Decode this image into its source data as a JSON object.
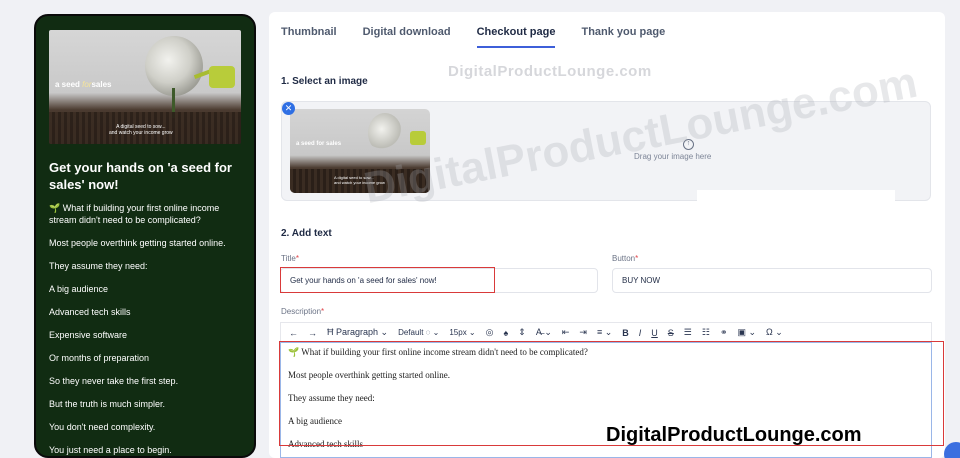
{
  "preview": {
    "hero_brand_a": "a seed",
    "hero_brand_b": "for",
    "hero_brand_c": "sales",
    "hero_tagline_1": "A digital seed to sow...",
    "hero_tagline_2": "and watch your income grow",
    "heading": "Get your hands on 'a seed for sales' now!",
    "lines": [
      "🌱 What if building your first online income stream didn't need to be complicated?",
      "Most people overthink getting started online.",
      "They assume they need:",
      "A big audience",
      "Advanced tech skills",
      "Expensive software",
      "Or months of preparation",
      "So they never take the first step.",
      "But the truth is much simpler.",
      "You don't need complexity.",
      "You just need a place to begin."
    ]
  },
  "tabs": [
    "Thumbnail",
    "Digital download",
    "Checkout page",
    "Thank you page"
  ],
  "active_tab": "Checkout page",
  "section1": "1. Select an image",
  "dropzone": {
    "label": "Drag your image here",
    "thumb_brand": "a seed for sales",
    "thumb_tag_1": "A digital seed to sow...",
    "thumb_tag_2": "and watch your income grow"
  },
  "section2": "2. Add text",
  "title_field": {
    "label": "Title",
    "value": "Get your hands on 'a seed for sales' now!"
  },
  "button_field": {
    "label": "Button",
    "value": "BUY NOW"
  },
  "description_label": "Description",
  "toolbar": {
    "paragraph": "Paragraph",
    "font": "Default",
    "size": "15px"
  },
  "editor_lines": [
    "🌱 What if building your first online income stream didn't need to be complicated?",
    "Most people overthink getting started online.",
    "They assume they need:",
    "A big audience",
    "Advanced tech skills"
  ],
  "watermarks": {
    "small": "DigitalProductLounge.com",
    "big": "DigitalProductLounge.com",
    "bottom": "DigitalProductLounge.com"
  },
  "colors": {
    "accent": "#3d5fd9",
    "highlight": "#d93a3a",
    "preview_bg": "#112c12"
  }
}
